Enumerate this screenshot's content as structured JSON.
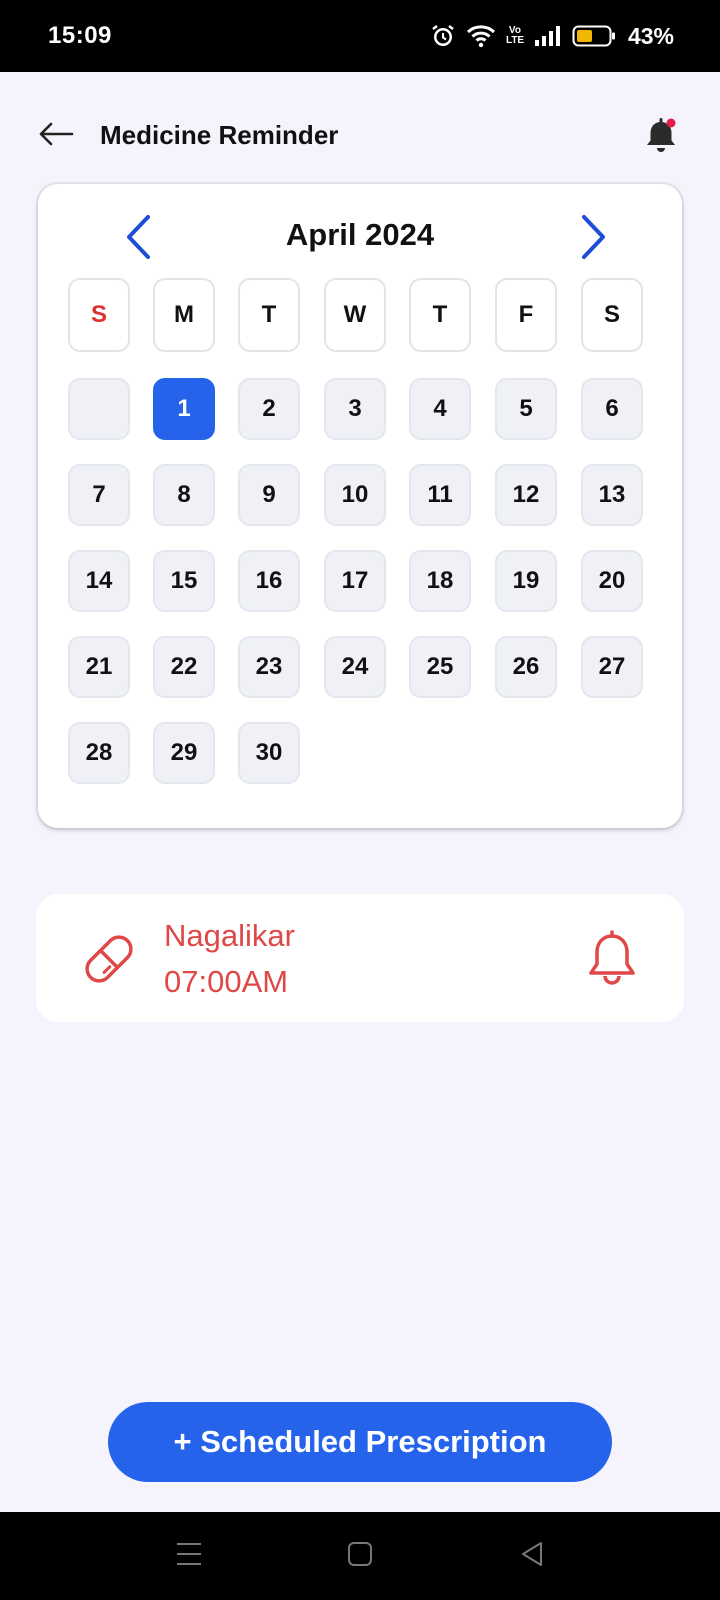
{
  "status_bar": {
    "time": "15:09",
    "battery_percent": "43%",
    "volte_line1": "Vo",
    "volte_line2": "LTE",
    "icons": [
      "alarm-icon",
      "wifi-icon",
      "volte-icon",
      "signal-icon",
      "battery-icon"
    ]
  },
  "header": {
    "title": "Medicine Reminder",
    "back_icon": "arrow-left-icon",
    "notification_icon": "bell-with-dot-icon"
  },
  "calendar": {
    "month_label": "April 2024",
    "prev_icon": "chevron-left-icon",
    "next_icon": "chevron-right-icon",
    "weekdays": [
      "S",
      "M",
      "T",
      "W",
      "T",
      "F",
      "S"
    ],
    "leading_empty": 1,
    "days": [
      "1",
      "2",
      "3",
      "4",
      "5",
      "6",
      "7",
      "8",
      "9",
      "10",
      "11",
      "12",
      "13",
      "14",
      "15",
      "16",
      "17",
      "18",
      "19",
      "20",
      "21",
      "22",
      "23",
      "24",
      "25",
      "26",
      "27",
      "28",
      "29",
      "30"
    ],
    "selected_day": "1"
  },
  "reminder": {
    "name": "Nagalikar",
    "time": "07:00AM",
    "pill_icon": "pill-icon",
    "bell_icon": "bell-icon"
  },
  "actions": {
    "scheduled_prescription": "+ Scheduled Prescription"
  },
  "navigation": {
    "buttons": [
      "menu-icon",
      "home-icon",
      "back-triangle-icon"
    ]
  },
  "colors": {
    "primary": "#2563eb",
    "accent_red": "#e04848",
    "background": "#f5f4fd"
  }
}
